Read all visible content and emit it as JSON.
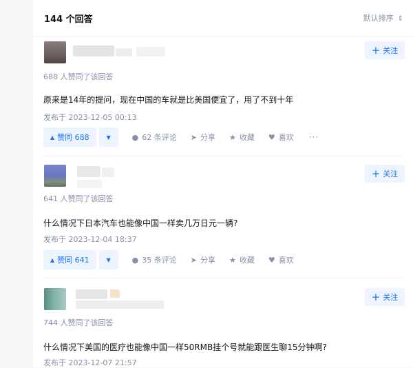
{
  "header": {
    "answer_count": "144 个回答",
    "sort_label": "默认排序",
    "sort_icon": "⇕"
  },
  "follow_label": "关注",
  "answers": [
    {
      "likes_line": "688 人赞同了该回答",
      "text": "原来是14年的提问，现在中国的车就是比美国便宜了，用了不到十年",
      "published": "发布于 2023-12-05 00:13",
      "vote_label": "赞同 688",
      "comments": "62 条评论",
      "share": "分享",
      "collect": "收藏",
      "like": "喜欢",
      "more": "···"
    },
    {
      "likes_line": "641 人赞同了该回答",
      "text": "什么情况下日本汽车也能像中国一样卖几万日元一辆?",
      "published": "发布于 2023-12-04 18:37",
      "vote_label": "赞同 641",
      "comments": "35 条评论",
      "share": "分享",
      "collect": "收藏",
      "like": "喜欢"
    },
    {
      "likes_line": "744 人赞同了该回答",
      "text": "什么情况下美国的医疗也能像中国一样50RMB挂个号就能跟医生聊15分钟啊?",
      "published": "发布于 2023-12-07 21:57"
    }
  ],
  "colors": {
    "accent": "#1772f6",
    "accent_bg": "#eef4ff",
    "muted": "#8590a6"
  }
}
